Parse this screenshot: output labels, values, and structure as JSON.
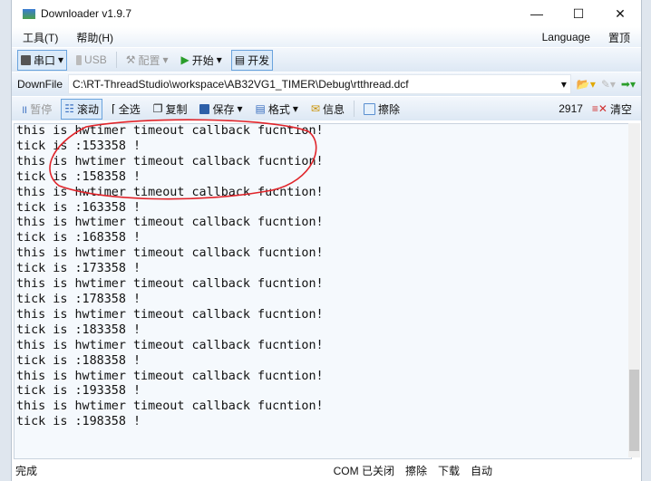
{
  "window": {
    "title": "Downloader v1.9.7",
    "minimize": "—",
    "maximize": "☐",
    "close": "✕"
  },
  "menu": {
    "tools": "工具(T)",
    "help": "帮助(H)",
    "language": "Language",
    "pin": "置顶"
  },
  "toolbar1": {
    "serial": "串口",
    "usb": "USB",
    "config": "配置",
    "start": "开始",
    "develop": "开发"
  },
  "downfile": {
    "label": "DownFile",
    "path": "C:\\RT-ThreadStudio\\workspace\\AB32VG1_TIMER\\Debug\\rtthread.dcf"
  },
  "toolbar2": {
    "pause": "暂停",
    "scroll": "滚动",
    "select_all": "全选",
    "copy": "复制",
    "save": "保存",
    "format": "格式",
    "info": "信息",
    "erase": "擦除",
    "count": "2917",
    "clear": "清空"
  },
  "console_lines": [
    "this is hwtimer timeout callback fucntion!",
    "tick is :153358 !",
    "this is hwtimer timeout callback fucntion!",
    "tick is :158358 !",
    "this is hwtimer timeout callback fucntion!",
    "tick is :163358 !",
    "this is hwtimer timeout callback fucntion!",
    "tick is :168358 !",
    "this is hwtimer timeout callback fucntion!",
    "tick is :173358 !",
    "this is hwtimer timeout callback fucntion!",
    "tick is :178358 !",
    "this is hwtimer timeout callback fucntion!",
    "tick is :183358 !",
    "this is hwtimer timeout callback fucntion!",
    "tick is :188358 !",
    "this is hwtimer timeout callback fucntion!",
    "tick is :193358 !",
    "this is hwtimer timeout callback fucntion!",
    "tick is :198358 !"
  ],
  "status": {
    "left": "完成",
    "com": "COM 已关闭",
    "erase": "擦除",
    "download": "下载",
    "auto": "自动"
  },
  "colors": {
    "annotation": "#e0242a",
    "console_bg": "#f5f9fd"
  }
}
